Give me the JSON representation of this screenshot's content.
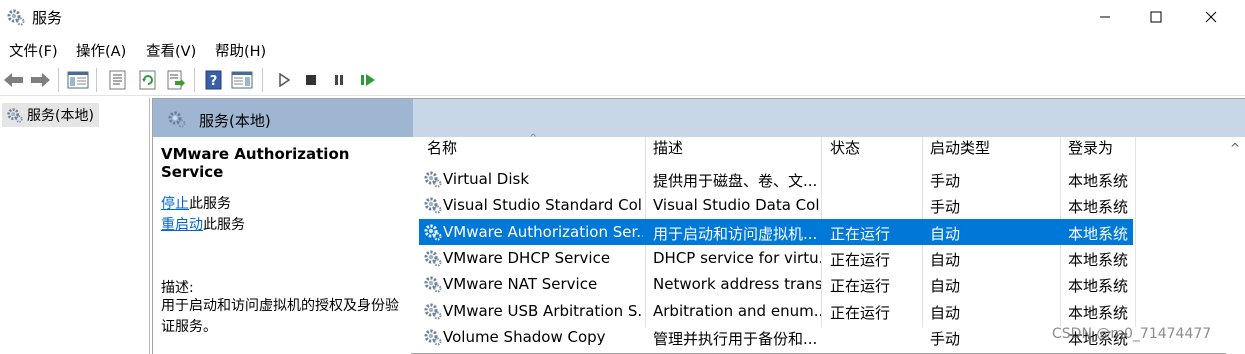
{
  "window": {
    "title": "服务",
    "icon": "gear-icon"
  },
  "menu": [
    "文件(F)",
    "操作(A)",
    "查看(V)",
    "帮助(H)"
  ],
  "toolbar": {
    "icons": [
      "back-arrow-icon",
      "forward-arrow-icon",
      "show-hide-tree-icon",
      "properties-icon",
      "refresh-icon",
      "export-list-icon",
      "help-icon",
      "show-hide-action-pane-icon",
      "start-service-icon",
      "stop-service-icon",
      "pause-service-icon",
      "restart-service-icon"
    ]
  },
  "tree": {
    "item_label": "服务(本地)"
  },
  "content_header": {
    "title": "服务(本地)"
  },
  "detail": {
    "service_name": "VMware Authorization Service",
    "stop_link": "停止",
    "stop_suffix": "此服务",
    "restart_link": "重启动",
    "restart_suffix": "此服务",
    "description_label": "描述:",
    "description_text": "用于启动和访问虚拟机的授权及身份验证服务。"
  },
  "columns": {
    "name": "名称",
    "description": "描述",
    "status": "状态",
    "startup_type": "启动类型",
    "logon_as": "登录为"
  },
  "services": [
    {
      "name": "Virtual Disk",
      "description": "提供用于磁盘、卷、文...",
      "status": "",
      "startup": "手动",
      "logon": "本地系统",
      "selected": false
    },
    {
      "name": "Visual Studio Standard Coll...",
      "description": "Visual Studio Data Col...",
      "status": "",
      "startup": "手动",
      "logon": "本地系统",
      "selected": false
    },
    {
      "name": "VMware Authorization Ser...",
      "description": "用于启动和访问虚拟机...",
      "status": "正在运行",
      "startup": "自动",
      "logon": "本地系统",
      "selected": true
    },
    {
      "name": "VMware DHCP Service",
      "description": "DHCP service for virtu...",
      "status": "正在运行",
      "startup": "自动",
      "logon": "本地系统",
      "selected": false
    },
    {
      "name": "VMware NAT Service",
      "description": "Network address trans...",
      "status": "正在运行",
      "startup": "自动",
      "logon": "本地系统",
      "selected": false
    },
    {
      "name": "VMware USB Arbitration S...",
      "description": "Arbitration and enum...",
      "status": "正在运行",
      "startup": "自动",
      "logon": "本地系统",
      "selected": false
    },
    {
      "name": "Volume Shadow Copy",
      "description": "管理并执行用于备份和...",
      "status": "",
      "startup": "手动",
      "logon": "本地系统",
      "selected": false
    }
  ],
  "watermark": "CSDN @m0_71474477",
  "colors": {
    "selection": "#0078d7",
    "header_band": "#c7d7e8",
    "header_tab": "#9fb6d3",
    "link": "#0066cc"
  }
}
